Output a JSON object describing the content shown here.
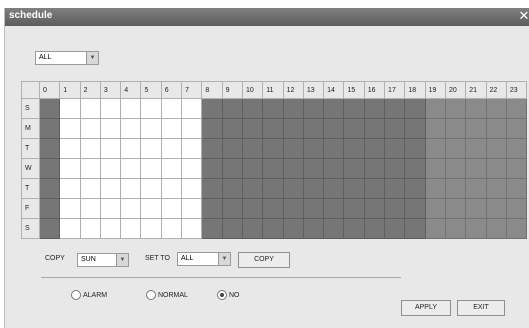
{
  "window": {
    "title": "schedule",
    "close_glyph": "✕"
  },
  "filter": {
    "value": "ALL"
  },
  "grid": {
    "hours": [
      "0",
      "1",
      "2",
      "3",
      "4",
      "5",
      "6",
      "7",
      "8",
      "9",
      "10",
      "11",
      "12",
      "13",
      "14",
      "15",
      "16",
      "17",
      "18",
      "19",
      "20",
      "21",
      "22",
      "23"
    ],
    "days": [
      "S",
      "M",
      "T",
      "W",
      "T",
      "F",
      "S"
    ]
  },
  "copy": {
    "label": "COPY",
    "source_day": "SUN",
    "set_to_label": "SET TO",
    "target_day": "ALL",
    "button_label": "COPY"
  },
  "record_type": {
    "options": [
      {
        "label": "ALARM",
        "selected": false
      },
      {
        "label": "NORMAL",
        "selected": false
      },
      {
        "label": "NO",
        "selected": true
      }
    ]
  },
  "actions": {
    "apply_label": "APPLY",
    "exit_label": "EXIT"
  }
}
